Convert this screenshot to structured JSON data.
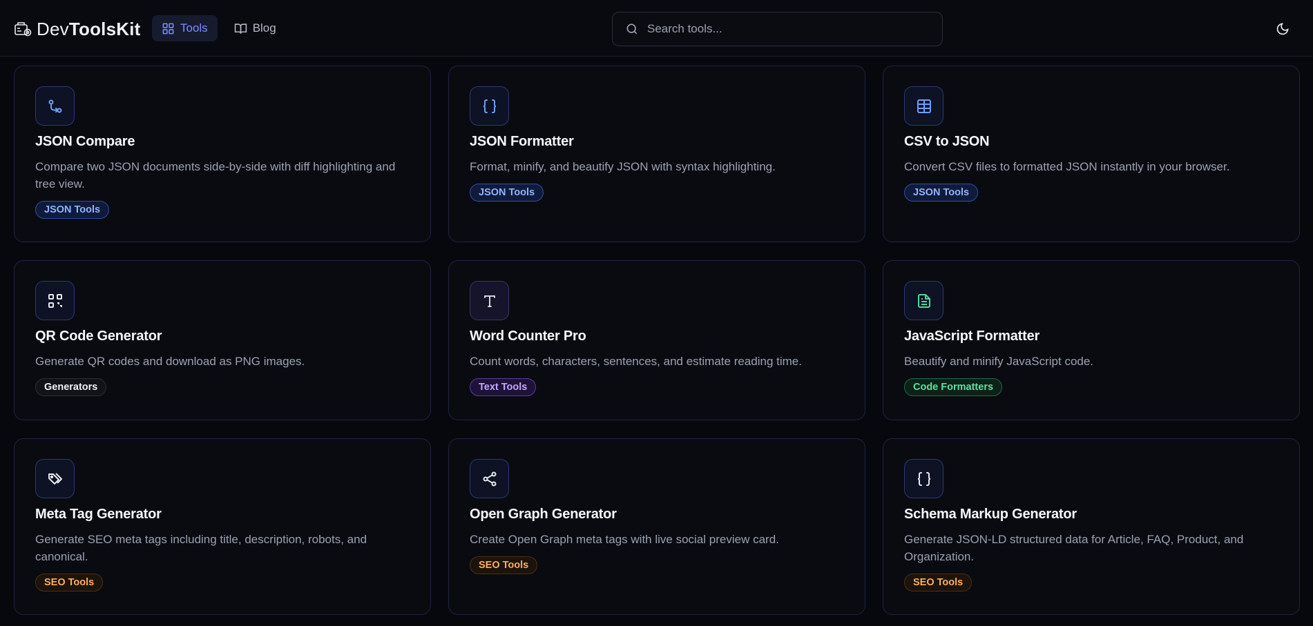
{
  "brand": {
    "name_prefix": "Dev",
    "name_suffix": "ToolsKit"
  },
  "nav": {
    "tools": "Tools",
    "blog": "Blog"
  },
  "search": {
    "placeholder": "Search tools..."
  },
  "colors": {
    "accent": "#7b8cff",
    "background": "#07080d",
    "card_border": "#1c2444"
  },
  "cards": [
    {
      "icon": "git-compare-icon",
      "title": "JSON Compare",
      "description": "Compare two JSON documents side-by-side with diff highlighting and tree view.",
      "badge": "JSON Tools"
    },
    {
      "icon": "braces-icon",
      "title": "JSON Formatter",
      "description": "Format, minify, and beautify JSON with syntax highlighting.",
      "badge": "JSON Tools"
    },
    {
      "icon": "table-icon",
      "title": "CSV to JSON",
      "description": "Convert CSV files to formatted JSON instantly in your browser.",
      "badge": "JSON Tools"
    },
    {
      "icon": "qr-code-icon",
      "title": "QR Code Generator",
      "description": "Generate QR codes and download as PNG images.",
      "badge": "Generators"
    },
    {
      "icon": "text-type-icon",
      "title": "Word Counter Pro",
      "description": "Count words, characters, sentences, and estimate reading time.",
      "badge": "Text Tools"
    },
    {
      "icon": "file-text-icon",
      "title": "JavaScript Formatter",
      "description": "Beautify and minify JavaScript code.",
      "badge": "Code Formatters"
    },
    {
      "icon": "tags-icon",
      "title": "Meta Tag Generator",
      "description": "Generate SEO meta tags including title, description, robots, and canonical.",
      "badge": "SEO Tools"
    },
    {
      "icon": "share-icon",
      "title": "Open Graph Generator",
      "description": "Create Open Graph meta tags with live social preview card.",
      "badge": "SEO Tools"
    },
    {
      "icon": "braces-icon",
      "title": "Schema Markup Generator",
      "description": "Generate JSON-LD structured data for Article, FAQ, Product, and Organization.",
      "badge": "SEO Tools"
    }
  ]
}
